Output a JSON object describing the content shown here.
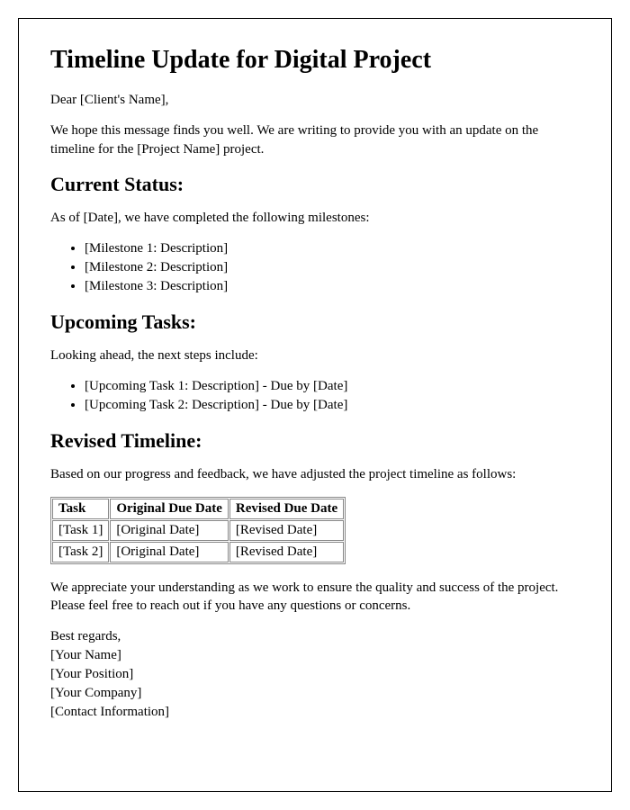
{
  "title": "Timeline Update for Digital Project",
  "greeting": "Dear [Client's Name],",
  "intro": "We hope this message finds you well. We are writing to provide you with an update on the timeline for the [Project Name] project.",
  "status": {
    "heading": "Current Status:",
    "intro": "As of [Date], we have completed the following milestones:",
    "milestones": [
      "[Milestone 1: Description]",
      "[Milestone 2: Description]",
      "[Milestone 3: Description]"
    ]
  },
  "upcoming": {
    "heading": "Upcoming Tasks:",
    "intro": "Looking ahead, the next steps include:",
    "tasks": [
      "[Upcoming Task 1: Description] - Due by [Date]",
      "[Upcoming Task 2: Description] - Due by [Date]"
    ]
  },
  "revised": {
    "heading": "Revised Timeline:",
    "intro": "Based on our progress and feedback, we have adjusted the project timeline as follows:",
    "headers": {
      "task": "Task",
      "original": "Original Due Date",
      "revised": "Revised Due Date"
    },
    "rows": [
      {
        "task": "[Task 1]",
        "original": "[Original Date]",
        "revised": "[Revised Date]"
      },
      {
        "task": "[Task 2]",
        "original": "[Original Date]",
        "revised": "[Revised Date]"
      }
    ]
  },
  "closing": "We appreciate your understanding as we work to ensure the quality and success of the project. Please feel free to reach out if you have any questions or concerns.",
  "signature": {
    "regards": "Best regards,",
    "name": "[Your Name]",
    "position": "[Your Position]",
    "company": "[Your Company]",
    "contact": "[Contact Information]"
  }
}
